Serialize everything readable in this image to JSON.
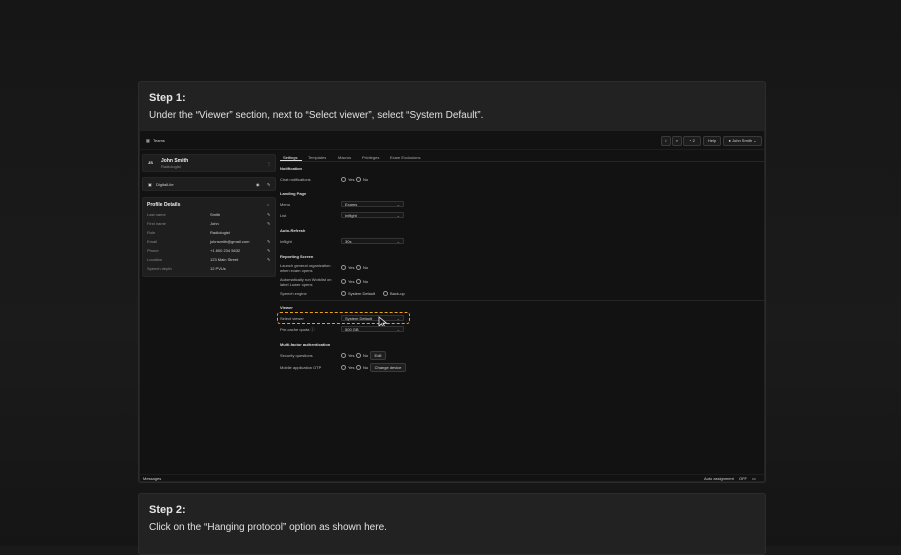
{
  "step1": {
    "title": "Step 1:",
    "text": "Under the “Viewer” section, next to “Select viewer”, select “System Default”."
  },
  "step2": {
    "title": "Step 2:",
    "text": "Click on the “Hanging protocol” option as shown here."
  },
  "app": {
    "team_label": "Teams",
    "toolbar": {
      "help": "Help",
      "user": "John Smith",
      "notif_count": "2"
    },
    "profile": {
      "initials": "JS",
      "name": "John Smith",
      "role": "Radiologist",
      "org": "DigitalLite"
    },
    "details": {
      "title": "Profile Details",
      "rows": [
        {
          "k": "Last name",
          "v": "Smith"
        },
        {
          "k": "First name",
          "v": "John"
        },
        {
          "k": "Role",
          "v": "Radiologist"
        },
        {
          "k": "Email",
          "v": "johnsmith@gmail.com"
        },
        {
          "k": "Phone",
          "v": "+1 800 234 5632"
        },
        {
          "k": "Location",
          "v": "123 Main Street"
        },
        {
          "k": "Speech depth",
          "v": "12 PVUs"
        }
      ]
    },
    "tabs": [
      "Settings",
      "Templates",
      "Macros",
      "Privileges",
      "Exam Exclusions"
    ],
    "sections": {
      "notification": "Notification",
      "chat_notifications": "Chat notifications",
      "landing": "Landing Page",
      "menu": "Menu",
      "menu_val": "Exams",
      "list": "List",
      "list_val": "Inflight",
      "auto_refresh": "Auto-Refresh",
      "inflight": "Inflight",
      "inflight_val": "30s",
      "reporting": "Reporting Screen",
      "launch_general": "Launch general organization when exam opens",
      "auto_run": "Automatically run Worklist on label Lower opens",
      "speech_engine": "Speech engine",
      "speech_default": "System Default",
      "speech_backup": "Back-up",
      "viewer": "Viewer",
      "select_viewer": "Select viewer",
      "select_viewer_val": "System Default",
      "pre_cache": "Pre-cache quota",
      "pre_cache_val": "500 GB",
      "mfa": "Multi-factor authentication",
      "security_q": "Security questions",
      "mobile_otp": "Mobile application OTP",
      "edit": "Edit",
      "change_device": "Change device",
      "yes": "Yes",
      "no": "No"
    },
    "footer": {
      "messages": "Messages",
      "auto_assign": "Auto assignment",
      "auto_assign_state": "OFF"
    }
  },
  "colors": {
    "highlight": "#e8a317",
    "card": "#222222",
    "app_bg": "#121212"
  }
}
